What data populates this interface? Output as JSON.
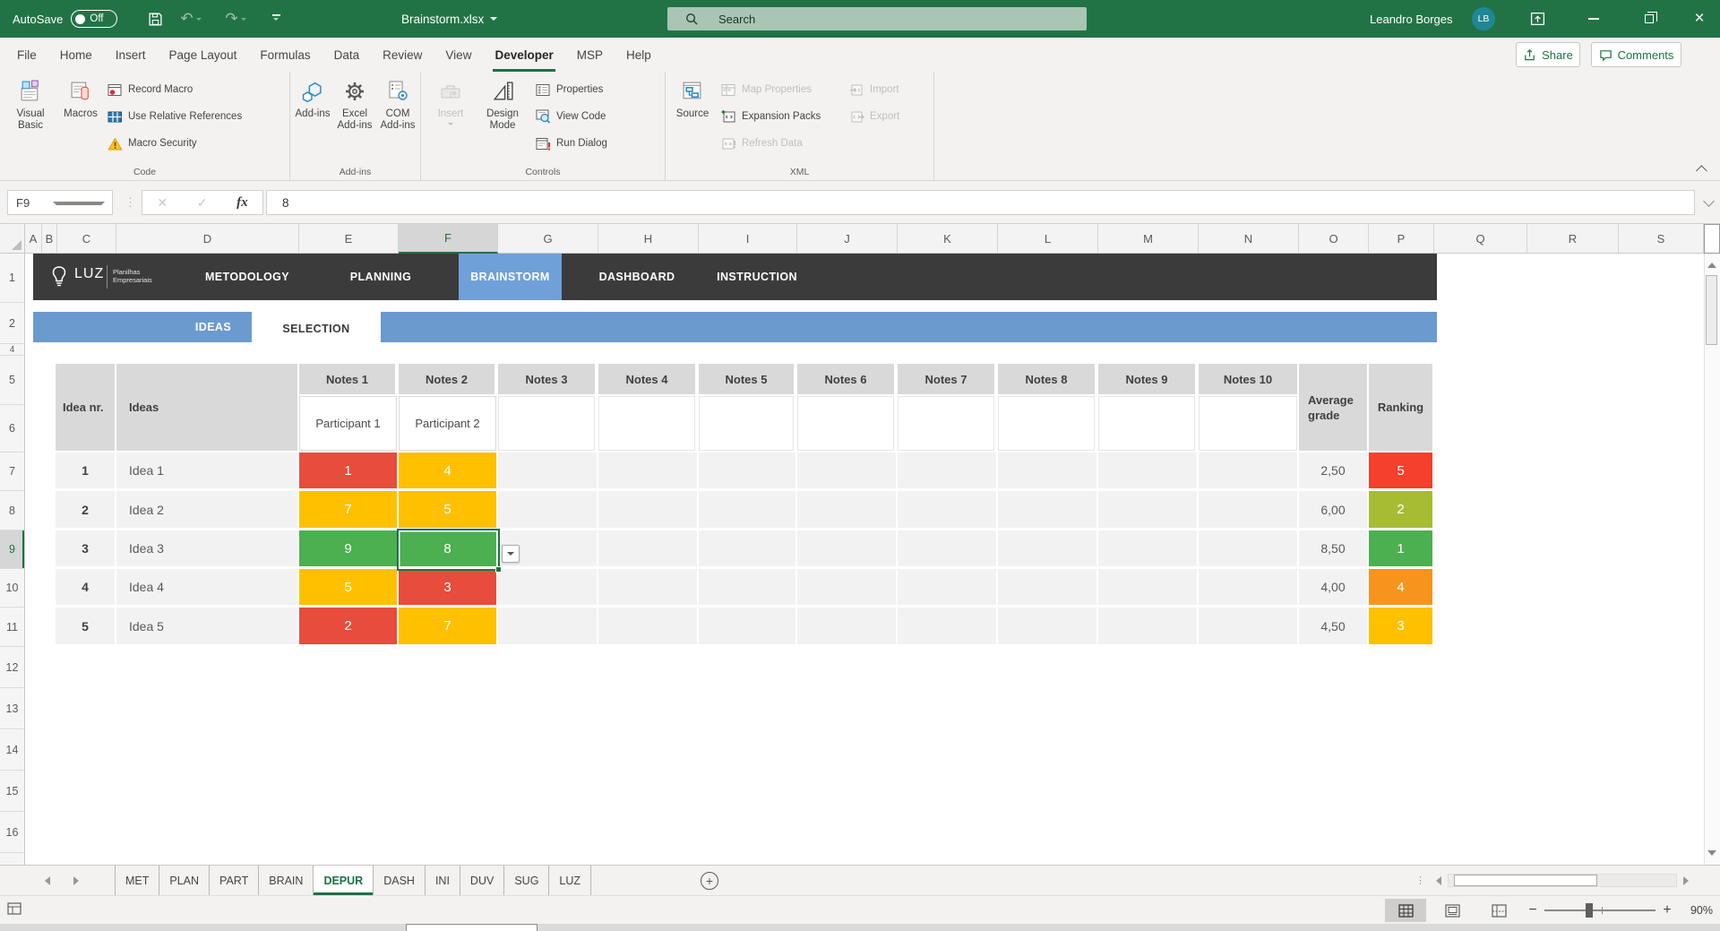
{
  "titlebar": {
    "autosave_label": "AutoSave",
    "autosave_state": "Off",
    "filename": "Brainstorm.xlsx",
    "search_placeholder": "Search",
    "user_name": "Leandro Borges",
    "user_initials": "LB"
  },
  "ribbon_tabs": [
    "File",
    "Home",
    "Insert",
    "Page Layout",
    "Formulas",
    "Data",
    "Review",
    "View",
    "Developer",
    "MSP",
    "Help"
  ],
  "active_ribbon_tab": "Developer",
  "quick_actions": {
    "share": "Share",
    "comments": "Comments"
  },
  "ribbon": {
    "code": {
      "group_label": "Code",
      "visual_basic": "Visual Basic",
      "macros": "Macros",
      "record_macro": "Record Macro",
      "use_relative_references": "Use Relative References",
      "macro_security": "Macro Security"
    },
    "addins": {
      "group_label": "Add-ins",
      "addins": "Add-ins",
      "excel_addins": "Excel Add-ins",
      "com_addins": "COM Add-ins"
    },
    "controls": {
      "group_label": "Controls",
      "insert": "Insert",
      "design_mode": "Design Mode",
      "properties": "Properties",
      "view_code": "View Code",
      "run_dialog": "Run Dialog"
    },
    "xml": {
      "group_label": "XML",
      "source": "Source",
      "map_properties": "Map Properties",
      "expansion_packs": "Expansion Packs",
      "refresh_data": "Refresh Data",
      "import": "Import",
      "export": "Export"
    }
  },
  "formula_bar": {
    "name_box": "F9",
    "formula": "8"
  },
  "grid": {
    "columns": [
      "A",
      "B",
      "C",
      "D",
      "E",
      "F",
      "G",
      "H",
      "I",
      "J",
      "K",
      "L",
      "M",
      "N",
      "O",
      "P",
      "Q",
      "R",
      "S"
    ],
    "rows": [
      "1",
      "2",
      "4",
      "5",
      "6",
      "7",
      "8",
      "9",
      "10",
      "11",
      "12",
      "13",
      "14",
      "15",
      "16"
    ],
    "selected_cell": "F9",
    "selected_column": "F",
    "selected_row": "9"
  },
  "workbook_nav": {
    "brand": "LUZ",
    "brand_subtitle_line1": "Planilhas",
    "brand_subtitle_line2": "Empresariais",
    "tabs": [
      "METODOLOGY",
      "PLANNING",
      "BRAINSTORM",
      "DASHBOARD",
      "INSTRUCTION"
    ],
    "active_tab": "BRAINSTORM",
    "subtabs": [
      "IDEAS",
      "SELECTION"
    ],
    "active_subtab": "SELECTION"
  },
  "table": {
    "headers": {
      "idea_nr": "Idea nr.",
      "ideas": "Ideas",
      "notes": [
        "Notes 1",
        "Notes 2",
        "Notes 3",
        "Notes 4",
        "Notes 5",
        "Notes 6",
        "Notes 7",
        "Notes 8",
        "Notes 9",
        "Notes 10"
      ],
      "participant_1": "Participant 1",
      "participant_2": "Participant 2",
      "average": "Average grade",
      "ranking": "Ranking"
    },
    "rows": [
      {
        "nr": "1",
        "idea": "Idea 1",
        "note1": "1",
        "note1_color": "#E74C3C",
        "note2": "4",
        "note2_color": "#FFC000",
        "average": "2,50",
        "rank": "5",
        "rank_color": "#F4402C"
      },
      {
        "nr": "2",
        "idea": "Idea 2",
        "note1": "7",
        "note1_color": "#FFC000",
        "note2": "5",
        "note2_color": "#FFC000",
        "average": "6,00",
        "rank": "2",
        "rank_color": "#A8BC33"
      },
      {
        "nr": "3",
        "idea": "Idea 3",
        "note1": "9",
        "note1_color": "#4CAF50",
        "note2": "8",
        "note2_color": "#4CAF50",
        "average": "8,50",
        "rank": "1",
        "rank_color": "#4CAF50"
      },
      {
        "nr": "4",
        "idea": "Idea 4",
        "note1": "5",
        "note1_color": "#FFC000",
        "note2": "3",
        "note2_color": "#E74C3C",
        "average": "4,00",
        "rank": "4",
        "rank_color": "#F7941E"
      },
      {
        "nr": "5",
        "idea": "Idea 5",
        "note1": "2",
        "note1_color": "#E74C3C",
        "note2": "7",
        "note2_color": "#FFC000",
        "average": "4,50",
        "rank": "3",
        "rank_color": "#FFC000"
      }
    ]
  },
  "sheet_tabs": {
    "tabs": [
      "MET",
      "PLAN",
      "PART",
      "BRAIN",
      "DEPUR",
      "DASH",
      "INI",
      "DUV",
      "SUG",
      "LUZ"
    ],
    "active": "DEPUR"
  },
  "status_bar": {
    "zoom_level": "90%"
  },
  "colors": {
    "titlebar_green": "#217346",
    "accent_green": "#1E7145",
    "nav_dark": "#3B3B3B",
    "nav_blue_active": "#6FA0D8",
    "subnav_blue": "#6B9ACF",
    "header_gray": "#D9D9D9",
    "row_gray": "#F2F2F2"
  }
}
